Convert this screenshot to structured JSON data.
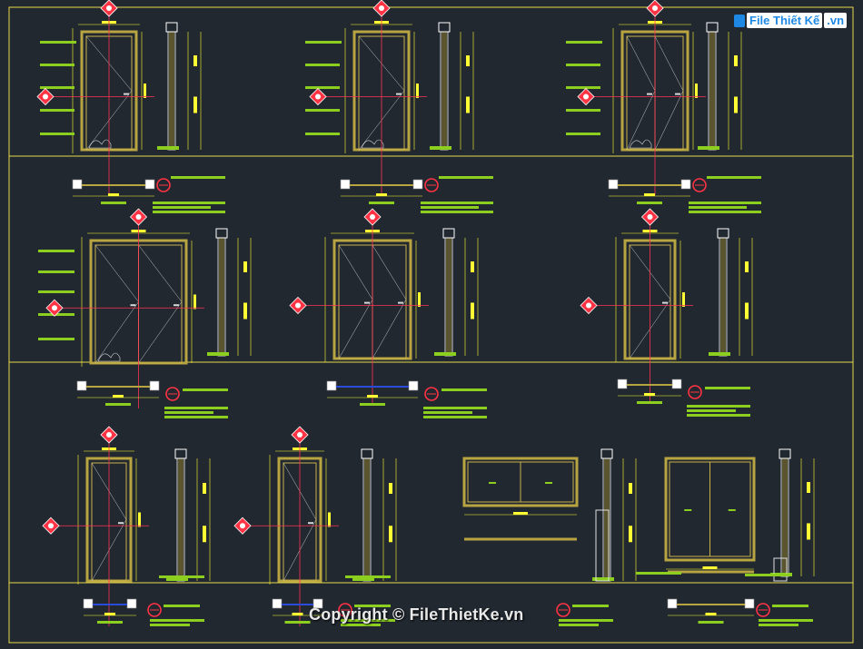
{
  "logo": {
    "brand": "File Thiết Kế",
    "suffix": ".vn"
  },
  "watermark": "Copyright © FileThietKe.vn",
  "colors": {
    "background": "#212830",
    "frame": "#e8d84a",
    "door": "#b8a440",
    "annotation": "#8ccf1e",
    "dimension": "#ffff33",
    "axis": "#ff3355",
    "tag": "#ff3344",
    "glass": "#2a4cd8"
  }
}
